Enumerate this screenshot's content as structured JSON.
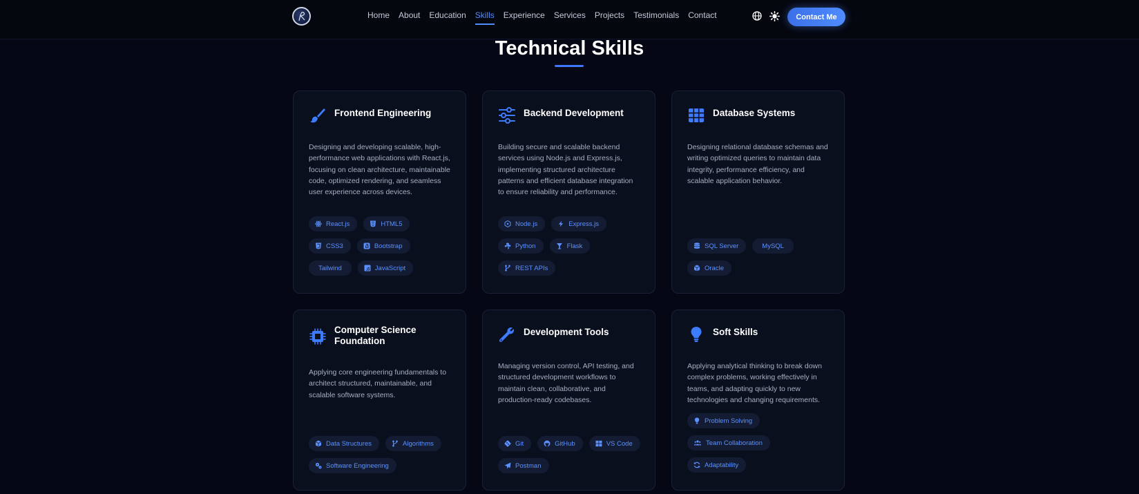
{
  "nav": {
    "links": [
      "Home",
      "About",
      "Education",
      "Skills",
      "Experience",
      "Services",
      "Projects",
      "Testimonials",
      "Contact"
    ],
    "active": "Skills",
    "contact_label": "Contact Me"
  },
  "section": {
    "title": "Technical Skills"
  },
  "colors": {
    "accent": "#4f8cff",
    "background": "#050814",
    "card": "#0a0f1e",
    "tag_bg": "#141c33"
  },
  "cards": [
    {
      "icon": "paintbrush-icon",
      "title": "Frontend Engineering",
      "description": "Designing and developing scalable, high-performance web applications with React.js, focusing on clean architecture, maintainable code, optimized rendering, and seamless user experience across devices.",
      "tags": [
        {
          "label": "React.js",
          "icon": "react-icon"
        },
        {
          "label": "HTML5",
          "icon": "html5-icon"
        },
        {
          "label": "CSS3",
          "icon": "css3-icon"
        },
        {
          "label": "Bootstrap",
          "icon": "bootstrap-icon"
        },
        {
          "label": "Tailwind",
          "icon": ""
        },
        {
          "label": "JavaScript",
          "icon": "javascript-icon"
        }
      ]
    },
    {
      "icon": "sliders-icon",
      "title": "Backend Development",
      "description": "Building secure and scalable backend services using Node.js and Express.js, implementing structured architecture patterns and efficient database integration to ensure reliability and performance.",
      "tags": [
        {
          "label": "Node.js",
          "icon": "nodejs-icon"
        },
        {
          "label": "Express.js",
          "icon": "bolt-icon"
        },
        {
          "label": "Python",
          "icon": "python-icon"
        },
        {
          "label": "Flask",
          "icon": "flask-icon"
        },
        {
          "label": "REST APIs",
          "icon": "branch-icon"
        }
      ]
    },
    {
      "icon": "table-icon",
      "title": "Database Systems",
      "description": "Designing relational database schemas and writing optimized queries to maintain data integrity, performance efficiency, and scalable application behavior.",
      "tags": [
        {
          "label": "SQL Server",
          "icon": "database-icon"
        },
        {
          "label": "MySQL",
          "icon": ""
        },
        {
          "label": "Oracle",
          "icon": "cube-icon"
        }
      ]
    },
    {
      "icon": "microchip-icon",
      "title": "Computer Science Foundation",
      "description": "Applying core engineering fundamentals to architect structured, maintainable, and scalable software systems.",
      "tags": [
        {
          "label": "Data Structures",
          "icon": "cube-icon"
        },
        {
          "label": "Algorithms",
          "icon": "branch-icon"
        },
        {
          "label": "Software Engineering",
          "icon": "gears-icon"
        }
      ]
    },
    {
      "icon": "wrench-icon",
      "title": "Development Tools",
      "description": "Managing version control, API testing, and structured development workflows to maintain clean, collaborative, and production-ready codebases.",
      "tags": [
        {
          "label": "Git",
          "icon": "git-icon"
        },
        {
          "label": "GitHub",
          "icon": "github-icon"
        },
        {
          "label": "VS Code",
          "icon": "windows-icon"
        },
        {
          "label": "Postman",
          "icon": "paper-plane-icon"
        }
      ]
    },
    {
      "icon": "lightbulb-icon",
      "title": "Soft Skills",
      "description": "Applying analytical thinking to break down complex problems, working effectively in teams, and adapting quickly to new technologies and changing requirements.",
      "tags": [
        {
          "label": "Problem Solving",
          "icon": "lightbulb-icon"
        },
        {
          "label": "Team Collaboration",
          "icon": "users-icon"
        },
        {
          "label": "Adaptability",
          "icon": "sync-icon"
        }
      ]
    }
  ]
}
